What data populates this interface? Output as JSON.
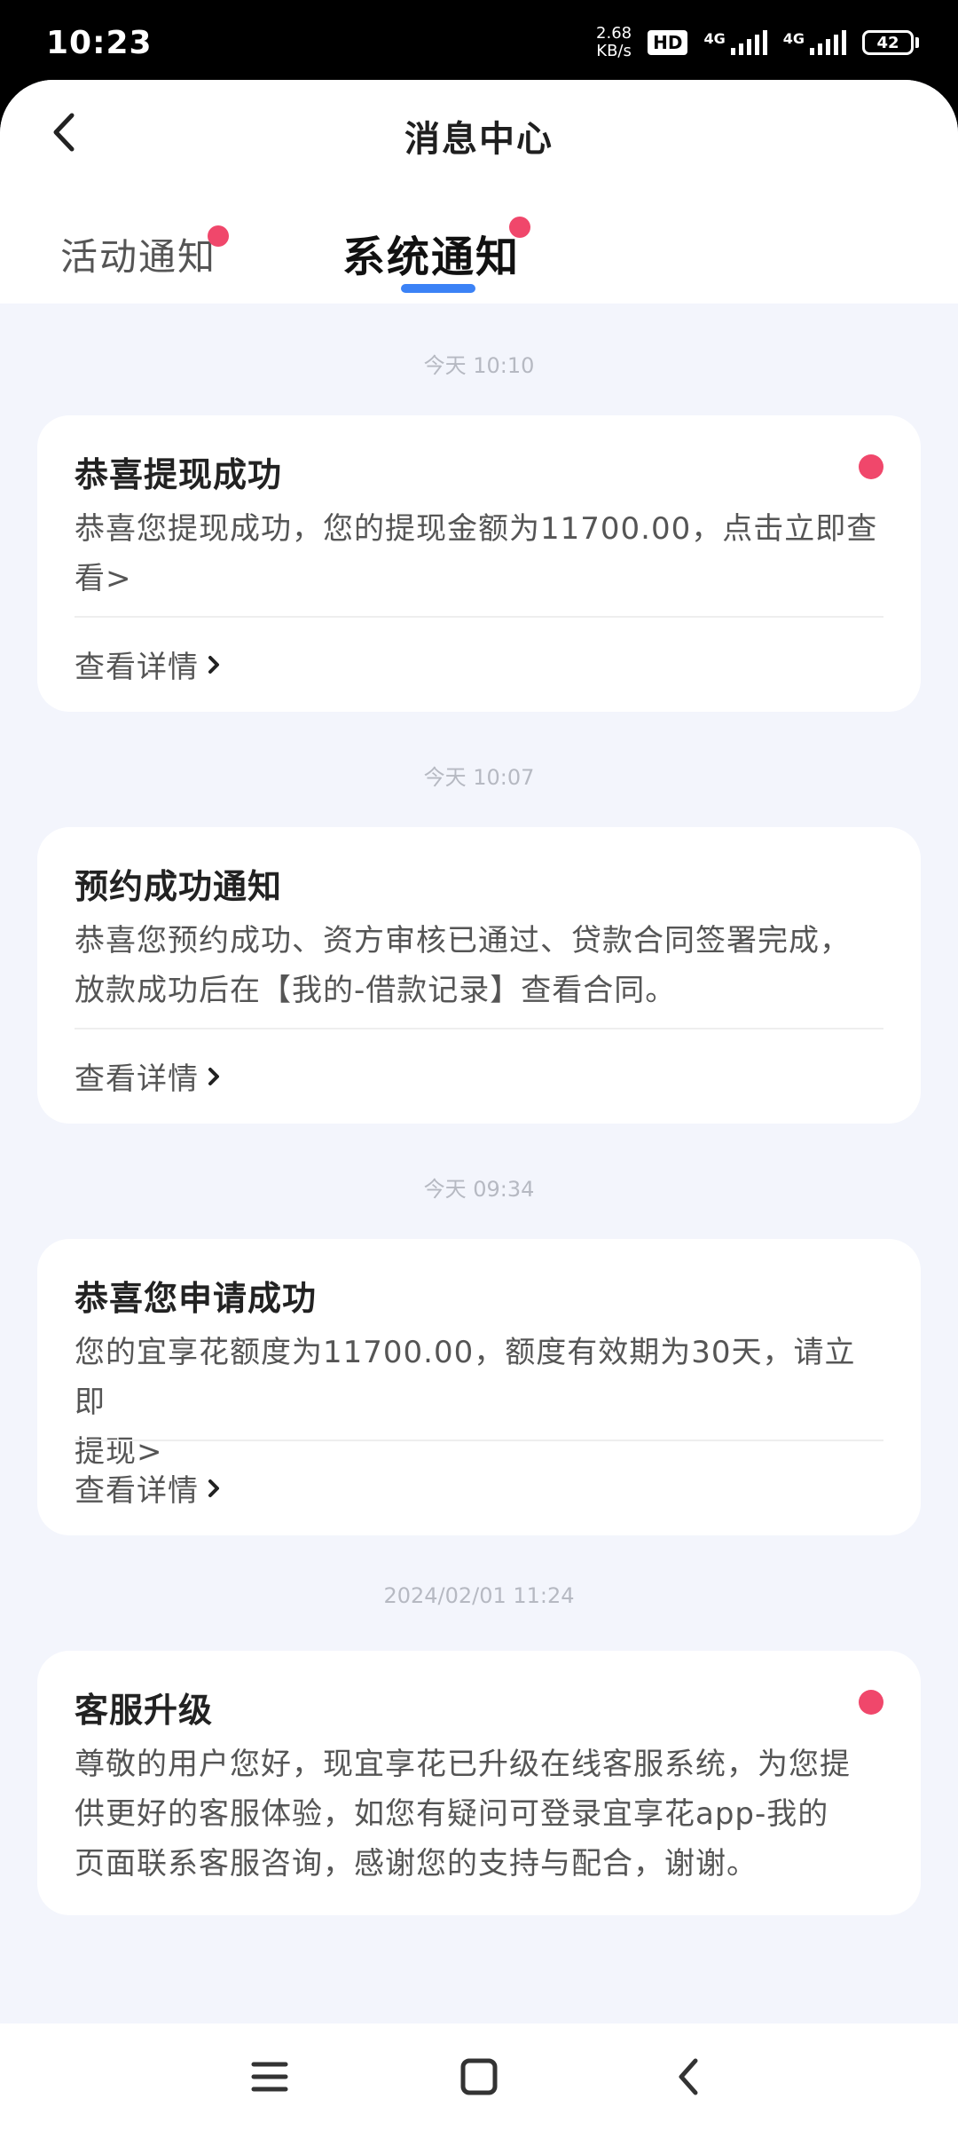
{
  "status_bar": {
    "time": "10:23",
    "speed_value": "2.68",
    "speed_unit": "KB/s",
    "hd_label": "HD",
    "net1": "4G",
    "net2": "4G",
    "battery": "42"
  },
  "header": {
    "title": "消息中心"
  },
  "tabs": [
    {
      "label": "活动通知",
      "active": false,
      "has_dot": true
    },
    {
      "label": "系统通知",
      "active": true,
      "has_dot": true
    }
  ],
  "messages": [
    {
      "time": "今天 10:10",
      "title": "恭喜提现成功",
      "unread": true,
      "body_line1": "恭喜您提现成功，您的提现金额为11700.00，点击立即查",
      "body_line2": "看>",
      "link": "查看详情"
    },
    {
      "time": "今天 10:07",
      "title": "预约成功通知",
      "unread": false,
      "body_line1": "恭喜您预约成功、资方审核已通过、贷款合同签署完成，",
      "body_line2": "放款成功后在【我的-借款记录】查看合同。",
      "link": "查看详情"
    },
    {
      "time": "今天 09:34",
      "title": "恭喜您申请成功",
      "unread": false,
      "body_line1": "您的宜享花额度为11700.00，额度有效期为30天，请立即",
      "body_line2": "提现>",
      "link": "查看详情"
    },
    {
      "time": "2024/02/01 11:24",
      "title": "客服升级",
      "unread": true,
      "body_line1": "尊敬的用户您好，现宜享花已升级在线客服系统，为您提",
      "body_line2": "供更好的客服体验，如您有疑问可登录宜享花app-我的",
      "body_line3": "页面联系客服咨询，感谢您的支持与配合，谢谢。"
    }
  ],
  "colors": {
    "accent": "#3b82f6",
    "badge": "#f0476b",
    "background": "#f3f5fc"
  },
  "icons": {
    "back": "chevron-left-icon",
    "link_arrow": "chevron-right-icon",
    "nav_menu": "menu-icon",
    "nav_home": "square-icon",
    "nav_back": "back-icon"
  }
}
